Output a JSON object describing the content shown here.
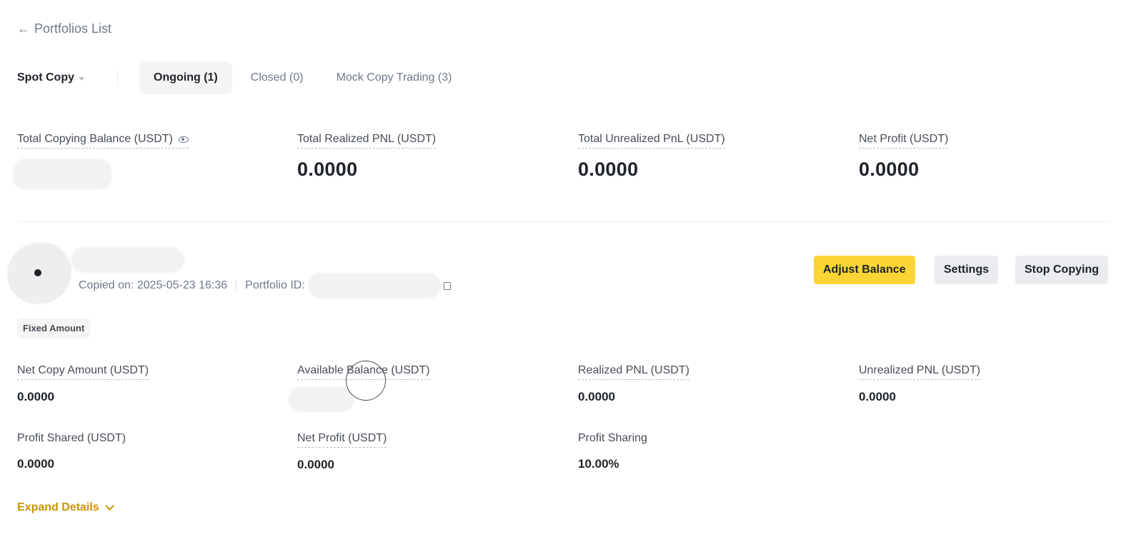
{
  "nav": {
    "back_label": "Portfolios List",
    "back_icon": "arrow-left-icon"
  },
  "tabs": {
    "type_select": "Spot Copy",
    "items": [
      {
        "label": "Ongoing (1)",
        "active": true
      },
      {
        "label": "Closed (0)",
        "active": false
      },
      {
        "label": "Mock Copy Trading (3)",
        "active": false
      }
    ]
  },
  "summary": {
    "items": [
      {
        "label": "Total Copying Balance (USDT)",
        "value": ""
      },
      {
        "label": "Total Realized PNL (USDT)",
        "value": "0.0000"
      },
      {
        "label": "Total Unrealized PnL (USDT)",
        "value": "0.0000"
      },
      {
        "label": "Net Profit (USDT)",
        "value": "0.0000"
      }
    ]
  },
  "portfolio": {
    "copied_on": "Copied on: 2025-05-23 16:36",
    "portfolio_id_label": "Portfolio ID:",
    "mode_tag": "Fixed Amount",
    "buttons": {
      "adjust": "Adjust Balance",
      "settings": "Settings",
      "stop": "Stop Copying"
    },
    "stats": [
      {
        "label": "Net Copy Amount (USDT)",
        "value": "0.0000"
      },
      {
        "label": "Available Balance (USDT)",
        "value": ""
      },
      {
        "label": "Realized PNL (USDT)",
        "value": "0.0000"
      },
      {
        "label": "Unrealized PNL (USDT)",
        "value": "0.0000"
      },
      {
        "label": "Profit Shared (USDT)",
        "value": "0.0000"
      },
      {
        "label": "Net Profit (USDT)",
        "value": "0.0000"
      },
      {
        "label": "Profit Sharing",
        "value": "10.00%"
      }
    ],
    "expand_label": "Expand Details"
  },
  "colors": {
    "accent": "#fcd535",
    "link": "#c99400",
    "text": "#1e2329",
    "muted": "#707a8a"
  }
}
